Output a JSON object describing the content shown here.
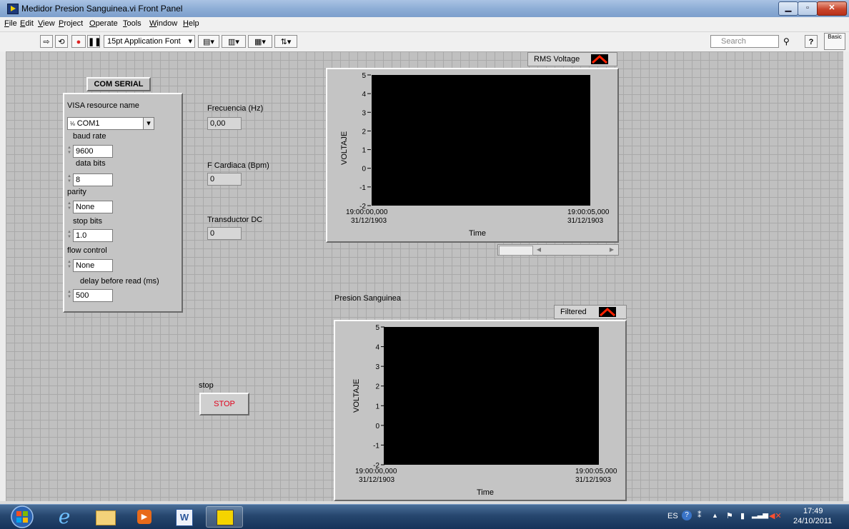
{
  "window": {
    "title": "Medidor Presion Sanguinea.vi Front Panel"
  },
  "menu": [
    "File",
    "Edit",
    "View",
    "Project",
    "Operate",
    "Tools",
    "Window",
    "Help"
  ],
  "toolbar": {
    "font": "15pt Application Font",
    "search_placeholder": "Search",
    "help_icon": "?",
    "basic_label": "Basic"
  },
  "com_serial": {
    "title": "COM SERIAL",
    "visa_label": "VISA resource name",
    "visa_value": "COM1",
    "baud_label": "baud rate",
    "baud_value": "9600",
    "databits_label": "data bits",
    "databits_value": "8",
    "parity_label": "parity",
    "parity_value": "None",
    "stopbits_label": "stop bits",
    "stopbits_value": "1.0",
    "flow_label": "flow control",
    "flow_value": "None",
    "delay_label": "delay before read (ms)",
    "delay_value": "500"
  },
  "indicators": {
    "freq_label": "Frecuencia (Hz)",
    "freq_value": "0,00",
    "fc_label": "F Cardiaca (Bpm)",
    "fc_value": "0",
    "trans_label": "Transductor DC",
    "trans_value": "0"
  },
  "stop": {
    "label": "stop",
    "button": "STOP"
  },
  "graph1": {
    "legend": "RMS Voltage",
    "ylabel": "VOLTAJE",
    "xlabel": "Time",
    "x_start": "19:00:00,000",
    "x_start_date": "31/12/1903",
    "x_end": "19:00:05,000",
    "x_end_date": "31/12/1903"
  },
  "graph2": {
    "title": "Presion Sanguinea",
    "legend": "Filtered",
    "ylabel": "VOLTAJE",
    "xlabel": "Time",
    "x_start": "19:00:00,000",
    "x_start_date": "31/12/1903",
    "x_end": "19:00:05,000",
    "x_end_date": "31/12/1903"
  },
  "chart_data": [
    {
      "type": "line",
      "title": "",
      "legend": [
        "RMS Voltage"
      ],
      "series": [
        {
          "name": "RMS Voltage",
          "values": []
        }
      ],
      "ylabel": "VOLTAJE",
      "xlabel": "Time",
      "ylim": [
        -2,
        5
      ],
      "yticks": [
        5,
        4,
        3,
        2,
        1,
        0,
        -1,
        -2
      ],
      "xlim": [
        "19:00:00,000 31/12/1903",
        "19:00:05,000 31/12/1903"
      ]
    },
    {
      "type": "line",
      "title": "Presion Sanguinea",
      "legend": [
        "Filtered"
      ],
      "series": [
        {
          "name": "Filtered",
          "values": []
        }
      ],
      "ylabel": "VOLTAJE",
      "xlabel": "Time",
      "ylim": [
        -2,
        5
      ],
      "yticks": [
        5,
        4,
        3,
        2,
        1,
        0,
        -1,
        -2
      ],
      "xlim": [
        "19:00:00,000 31/12/1903",
        "19:00:05,000 31/12/1903"
      ]
    }
  ],
  "taskbar": {
    "lang": "ES",
    "time": "17:49",
    "date": "24/10/2011"
  }
}
